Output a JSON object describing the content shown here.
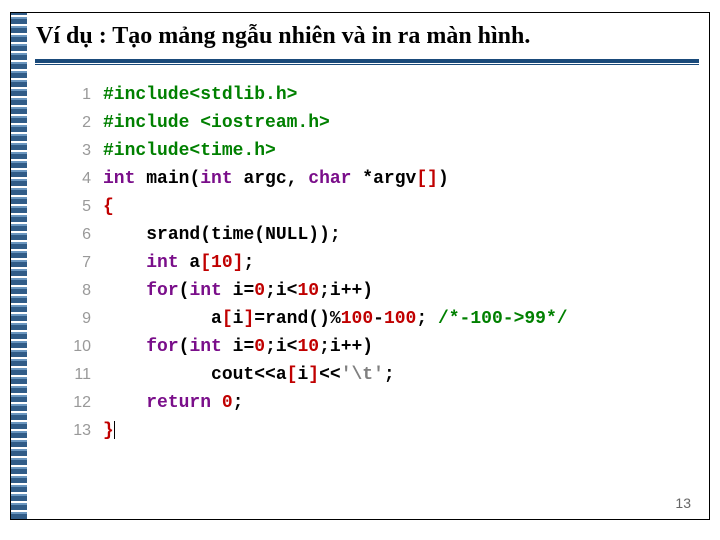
{
  "title": "Ví dụ : Tạo mảng ngẫu nhiên và in ra màn hình.",
  "page_number": "13",
  "code": {
    "lines": [
      {
        "n": "1",
        "tokens": [
          {
            "t": "#include<stdlib.h>",
            "c": "tk-preproc"
          }
        ]
      },
      {
        "n": "2",
        "tokens": [
          {
            "t": "#include <iostream.h>",
            "c": "tk-preproc"
          }
        ]
      },
      {
        "n": "3",
        "tokens": [
          {
            "t": "#include<time.h>",
            "c": "tk-preproc"
          }
        ]
      },
      {
        "n": "4",
        "tokens": [
          {
            "t": "int",
            "c": "tk-keyword"
          },
          {
            "t": " ",
            "c": ""
          },
          {
            "t": "main",
            "c": "tk-ident"
          },
          {
            "t": "(",
            "c": "tk-punct"
          },
          {
            "t": "int",
            "c": "tk-keyword"
          },
          {
            "t": " argc",
            "c": "tk-ident"
          },
          {
            "t": ", ",
            "c": "tk-punct"
          },
          {
            "t": "char",
            "c": "tk-keyword"
          },
          {
            "t": " *argv",
            "c": "tk-ident"
          },
          {
            "t": "[",
            "c": "tk-brack"
          },
          {
            "t": "]",
            "c": "tk-brack"
          },
          {
            "t": ")",
            "c": "tk-punct"
          }
        ]
      },
      {
        "n": "5",
        "tokens": [
          {
            "t": "{",
            "c": "tk-brace"
          }
        ]
      },
      {
        "n": "6",
        "tokens": [
          {
            "t": "    ",
            "c": ""
          },
          {
            "t": "srand",
            "c": "tk-ident"
          },
          {
            "t": "(",
            "c": "tk-punct"
          },
          {
            "t": "time",
            "c": "tk-ident"
          },
          {
            "t": "(",
            "c": "tk-punct"
          },
          {
            "t": "NULL",
            "c": "tk-ident"
          },
          {
            "t": ")",
            "c": "tk-punct"
          },
          {
            "t": ")",
            "c": "tk-punct"
          },
          {
            "t": ";",
            "c": "tk-punct"
          }
        ]
      },
      {
        "n": "7",
        "tokens": [
          {
            "t": "    ",
            "c": ""
          },
          {
            "t": "int",
            "c": "tk-keyword"
          },
          {
            "t": " a",
            "c": "tk-ident"
          },
          {
            "t": "[",
            "c": "tk-brack"
          },
          {
            "t": "10",
            "c": "tk-num"
          },
          {
            "t": "]",
            "c": "tk-brack"
          },
          {
            "t": ";",
            "c": "tk-punct"
          }
        ]
      },
      {
        "n": "8",
        "tokens": [
          {
            "t": "    ",
            "c": ""
          },
          {
            "t": "for",
            "c": "tk-keyword"
          },
          {
            "t": "(",
            "c": "tk-punct"
          },
          {
            "t": "int",
            "c": "tk-keyword"
          },
          {
            "t": " i",
            "c": "tk-ident"
          },
          {
            "t": "=",
            "c": "tk-punct"
          },
          {
            "t": "0",
            "c": "tk-num"
          },
          {
            "t": ";i<",
            "c": "tk-punct"
          },
          {
            "t": "10",
            "c": "tk-num"
          },
          {
            "t": ";i++)",
            "c": "tk-punct"
          }
        ]
      },
      {
        "n": "9",
        "tokens": [
          {
            "t": "          a",
            "c": "tk-ident"
          },
          {
            "t": "[",
            "c": "tk-brack"
          },
          {
            "t": "i",
            "c": "tk-ident"
          },
          {
            "t": "]",
            "c": "tk-brack"
          },
          {
            "t": "=",
            "c": "tk-punct"
          },
          {
            "t": "rand",
            "c": "tk-ident"
          },
          {
            "t": "()",
            "c": "tk-punct"
          },
          {
            "t": "%",
            "c": "tk-punct"
          },
          {
            "t": "100",
            "c": "tk-num"
          },
          {
            "t": "-",
            "c": "tk-punct"
          },
          {
            "t": "100",
            "c": "tk-num"
          },
          {
            "t": "; ",
            "c": "tk-punct"
          },
          {
            "t": "/*-100->99*/",
            "c": "tk-comment"
          }
        ]
      },
      {
        "n": "10",
        "tokens": [
          {
            "t": "    ",
            "c": ""
          },
          {
            "t": "for",
            "c": "tk-keyword"
          },
          {
            "t": "(",
            "c": "tk-punct"
          },
          {
            "t": "int",
            "c": "tk-keyword"
          },
          {
            "t": " i",
            "c": "tk-ident"
          },
          {
            "t": "=",
            "c": "tk-punct"
          },
          {
            "t": "0",
            "c": "tk-num"
          },
          {
            "t": ";i<",
            "c": "tk-punct"
          },
          {
            "t": "10",
            "c": "tk-num"
          },
          {
            "t": ";i++)",
            "c": "tk-punct"
          }
        ]
      },
      {
        "n": "11",
        "tokens": [
          {
            "t": "          cout",
            "c": "tk-ident"
          },
          {
            "t": "<<a",
            "c": "tk-punct"
          },
          {
            "t": "[",
            "c": "tk-brack"
          },
          {
            "t": "i",
            "c": "tk-ident"
          },
          {
            "t": "]",
            "c": "tk-brack"
          },
          {
            "t": "<<",
            "c": "tk-punct"
          },
          {
            "t": "'\\t'",
            "c": "tk-str"
          },
          {
            "t": ";",
            "c": "tk-punct"
          }
        ]
      },
      {
        "n": "12",
        "tokens": [
          {
            "t": "    ",
            "c": ""
          },
          {
            "t": "return",
            "c": "tk-keyword"
          },
          {
            "t": " ",
            "c": ""
          },
          {
            "t": "0",
            "c": "tk-num"
          },
          {
            "t": ";",
            "c": "tk-punct"
          }
        ]
      },
      {
        "n": "13",
        "tokens": [
          {
            "t": "}",
            "c": "tk-brace"
          },
          {
            "t": "CURSOR",
            "c": "cursor"
          }
        ]
      }
    ]
  }
}
